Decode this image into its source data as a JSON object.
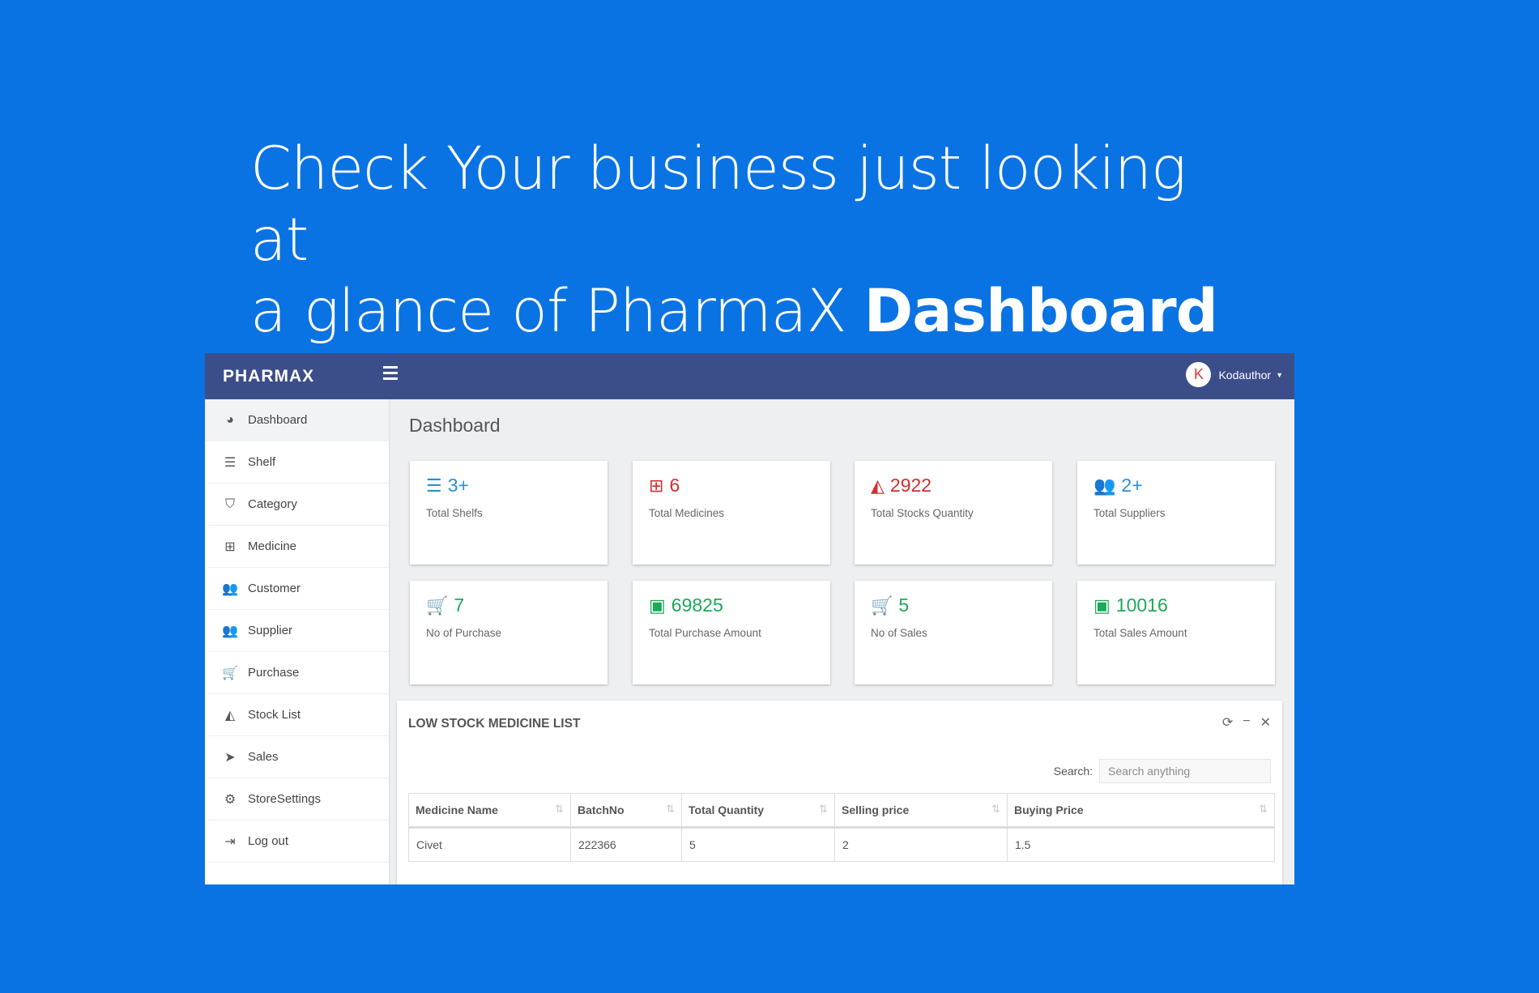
{
  "headline": {
    "line1": "Check Your business just looking at",
    "line2_prefix": "a glance of PharmaX ",
    "line2_bold": "Dashboard"
  },
  "topbar": {
    "brand": "PHARMAX",
    "user_initial": "K",
    "user_name": "Kodauthor",
    "caret": "▼"
  },
  "sidebar": {
    "items": [
      {
        "label": "Dashboard",
        "icon": "dashboard-icon",
        "glyph": "◕"
      },
      {
        "label": "Shelf",
        "icon": "list-icon",
        "glyph": "☰"
      },
      {
        "label": "Category",
        "icon": "tags-icon",
        "glyph": "⛉"
      },
      {
        "label": "Medicine",
        "icon": "medkit-icon",
        "glyph": "⊞"
      },
      {
        "label": "Customer",
        "icon": "users-icon",
        "glyph": "👥"
      },
      {
        "label": "Supplier",
        "icon": "users-icon",
        "glyph": "👥"
      },
      {
        "label": "Purchase",
        "icon": "cart-icon",
        "glyph": "🛒"
      },
      {
        "label": "Stock List",
        "icon": "area-chart-icon",
        "glyph": "◭"
      },
      {
        "label": "Sales",
        "icon": "send-icon",
        "glyph": "➤"
      },
      {
        "label": "StoreSettings",
        "icon": "gear-icon",
        "glyph": "⚙"
      },
      {
        "label": "Log out",
        "icon": "sign-out-icon",
        "glyph": "⇥"
      }
    ]
  },
  "page_title": "Dashboard",
  "cards": [
    {
      "value": "3+",
      "label": "Total Shelfs",
      "icon": "list-icon",
      "glyph": "☰",
      "color": "#2d8fd5"
    },
    {
      "value": "6",
      "label": "Total Medicines",
      "icon": "medkit-icon",
      "glyph": "⊞",
      "color": "#d12f2f"
    },
    {
      "value": "2922",
      "label": "Total Stocks Quantity",
      "icon": "area-chart-icon",
      "glyph": "◭",
      "color": "#d12f2f"
    },
    {
      "value": "2+",
      "label": "Total Suppliers",
      "icon": "users-icon",
      "glyph": "👥",
      "color": "#2d8fd5"
    },
    {
      "value": "7",
      "label": "No of Purchase",
      "icon": "cart-icon",
      "glyph": "🛒",
      "color": "#1ea858"
    },
    {
      "value": "69825",
      "label": "Total Purchase Amount",
      "icon": "money-icon",
      "glyph": "▣",
      "color": "#1ea858"
    },
    {
      "value": "5",
      "label": "No of Sales",
      "icon": "cart-icon",
      "glyph": "🛒",
      "color": "#1ea858"
    },
    {
      "value": "10016",
      "label": "Total Sales Amount",
      "icon": "money-icon",
      "glyph": "▣",
      "color": "#1ea858"
    }
  ],
  "panel": {
    "title": "LOW STOCK MEDICINE LIST",
    "search_label": "Search:",
    "search_placeholder": "Search anything",
    "columns": [
      "Medicine Name",
      "BatchNo",
      "Total Quantity",
      "Selling price",
      "Buying Price"
    ],
    "rows": [
      [
        "Civet",
        "222366",
        "5",
        "2",
        "1.5"
      ]
    ]
  }
}
